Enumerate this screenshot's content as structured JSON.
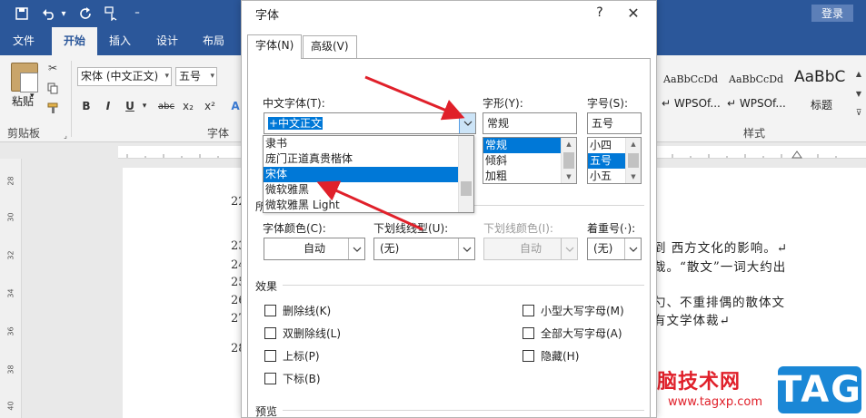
{
  "titlebar": {
    "quick_access": [
      "save-icon",
      "undo-icon",
      "redo-icon",
      "touch-mode-icon",
      "customize-icon"
    ],
    "undo_dropdown": "▾",
    "customize_label": "⁼",
    "login_label": "登录"
  },
  "ribbon_tabs": [
    "文件",
    "开始",
    "插入",
    "设计",
    "布局"
  ],
  "ribbon": {
    "paste_label": "粘贴",
    "clipboard_label": "剪贴板",
    "font_group_label": "字体",
    "styles_group_label": "样式",
    "font_name": "宋体 (中文正文)",
    "font_size": "五号",
    "format_buttons": [
      "B",
      "I",
      "U",
      "abc",
      "x₂",
      "x²"
    ],
    "styles": [
      {
        "sample": "AaBbCcDd",
        "name": "↵ WPSOf..."
      },
      {
        "sample": "AaBbCcDd",
        "name": "↵ WPSOf..."
      },
      {
        "sample": "AaBbC",
        "name": "标题"
      }
    ],
    "colors": {
      "accent": "#2b579a",
      "ribbon_bg": "#f3f3f3"
    }
  },
  "document": {
    "vertical_ruler": [
      "28",
      "30",
      "32",
      "34",
      "36",
      "38",
      "40"
    ],
    "line_numbers": [
      "22",
      "23",
      "24",
      "25",
      "26",
      "27",
      "28"
    ],
    "text_lines": [
      "到 西方文化的影响。↵",
      "哉。“散文”一词大约出",
      "勺、不重排偶的散体文",
      "有文学体裁↵"
    ]
  },
  "dialog": {
    "title": "字体",
    "help": "?",
    "close": "✕",
    "tabs": [
      "字体(N)",
      "高级(V)"
    ],
    "chinese_font_label": "中文字体(T):",
    "chinese_font_value": "+中文正文",
    "font_list": [
      "隶书",
      "庞门正道真贵楷体",
      "宋体",
      "微软雅黑",
      "微软雅黑 Light"
    ],
    "font_list_selected": 2,
    "style_label": "字形(Y):",
    "style_value": "常规",
    "style_list": [
      "常规",
      "倾斜",
      "加粗"
    ],
    "style_list_selected": 0,
    "size_label": "字号(S):",
    "size_value": "五号",
    "size_list": [
      "小四",
      "五号",
      "小五"
    ],
    "size_list_selected": 1,
    "all_text_label": "所",
    "font_color_label": "字体颜色(C):",
    "font_color_value": "自动",
    "underline_label": "下划线线型(U):",
    "underline_value": "(无)",
    "underline_color_label": "下划线颜色(I):",
    "underline_color_value": "自动",
    "emphasis_label": "着重号(·):",
    "emphasis_value": "(无)",
    "effects_label": "效果",
    "effects_left": [
      "删除线(K)",
      "双删除线(L)",
      "上标(P)",
      "下标(B)"
    ],
    "effects_right": [
      "小型大写字母(M)",
      "全部大写字母(A)",
      "隐藏(H)"
    ],
    "preview_label": "预览"
  },
  "watermark": {
    "site_text": "电脑技术网",
    "url": "www.tagxp.com",
    "tag": "TAG"
  },
  "annotation_colors": {
    "arrow": "#e0202a",
    "selection": "#0078d7"
  }
}
